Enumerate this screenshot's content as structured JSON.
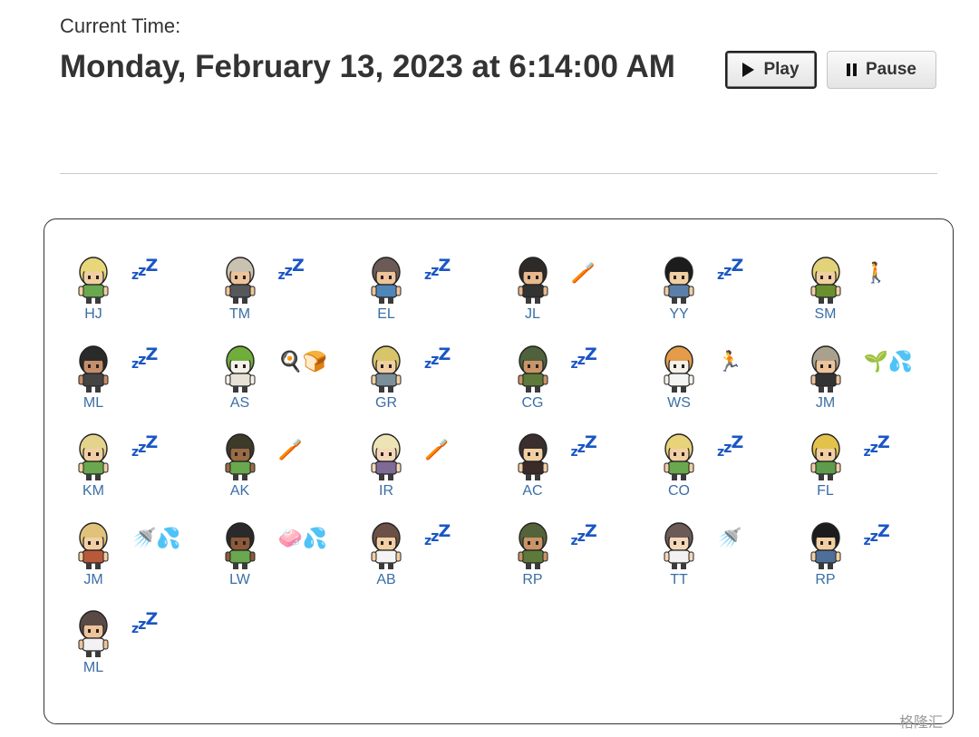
{
  "header": {
    "current_time_label": "Current Time:",
    "current_time_value": "Monday, February 13, 2023 at 6:14:00 AM"
  },
  "controls": {
    "play_label": "Play",
    "pause_label": "Pause"
  },
  "personas": [
    {
      "initials": "HJ",
      "status": "😴",
      "hair": "#e8d77a",
      "skin": "#f2cfa2",
      "shirt": "#6aa84f"
    },
    {
      "initials": "TM",
      "status": "😴",
      "hair": "#c9c2b2",
      "skin": "#eec39a",
      "shirt": "#55575a"
    },
    {
      "initials": "EL",
      "status": "😴",
      "hair": "#6b5a55",
      "skin": "#eec39a",
      "shirt": "#4f86b8"
    },
    {
      "initials": "JL",
      "status": "🪥",
      "hair": "#2e2a28",
      "skin": "#e9b98e",
      "shirt": "#333333"
    },
    {
      "initials": "YY",
      "status": "😴",
      "hair": "#1c1c1c",
      "skin": "#f2cfa2",
      "shirt": "#5a7fa8"
    },
    {
      "initials": "SM",
      "status": "🚶",
      "hair": "#e2d27a",
      "skin": "#f2cfa2",
      "shirt": "#6a8f2f"
    },
    {
      "initials": "ML",
      "status": "😴",
      "hair": "#2a2a2a",
      "skin": "#c58e6a",
      "shirt": "#444444"
    },
    {
      "initials": "AS",
      "status": "🍳🍞",
      "hair": "#6fae3a",
      "skin": "#f6f1e8",
      "shirt": "#e8e2d6"
    },
    {
      "initials": "GR",
      "status": "😴",
      "hair": "#d7c56a",
      "skin": "#f2cfa2",
      "shirt": "#7a8f9a"
    },
    {
      "initials": "CG",
      "status": "😴",
      "hair": "#50613d",
      "skin": "#c99468",
      "shirt": "#5d7a3a"
    },
    {
      "initials": "WS",
      "status": "🏃",
      "hair": "#e49b4a",
      "skin": "#f6f1e8",
      "shirt": "#f4f4f4"
    },
    {
      "initials": "JM",
      "status": "🌱💦",
      "hair": "#a9a18e",
      "skin": "#eec39a",
      "shirt": "#333333"
    },
    {
      "initials": "KM",
      "status": "😴",
      "hair": "#e3d38c",
      "skin": "#f2cfa2",
      "shirt": "#6aa84f"
    },
    {
      "initials": "AK",
      "status": "🪥",
      "hair": "#3d3a2a",
      "skin": "#9a6b45",
      "shirt": "#6aa84f"
    },
    {
      "initials": "IR",
      "status": "🪥",
      "hair": "#ede4b6",
      "skin": "#f5d7b8",
      "shirt": "#7d6b95"
    },
    {
      "initials": "AC",
      "status": "😴",
      "hair": "#3a2e2e",
      "skin": "#f2cfa2",
      "shirt": "#3a2a2a"
    },
    {
      "initials": "CO",
      "status": "😴",
      "hair": "#e8d27a",
      "skin": "#f2cfa2",
      "shirt": "#6aa84f"
    },
    {
      "initials": "FL",
      "status": "😴",
      "hair": "#e2c24a",
      "skin": "#f2cfa2",
      "shirt": "#5c9c4a"
    },
    {
      "initials": "JM",
      "status": "🚿💦",
      "hair": "#e0c27a",
      "skin": "#f2cfa2",
      "shirt": "#b85a3a"
    },
    {
      "initials": "LW",
      "status": "🧼💦",
      "hair": "#2a2a2a",
      "skin": "#8c5a3a",
      "shirt": "#6aa84f"
    },
    {
      "initials": "AB",
      "status": "😴",
      "hair": "#6b5045",
      "skin": "#f2cfa2",
      "shirt": "#f4f4f4"
    },
    {
      "initials": "RP",
      "status": "😴",
      "hair": "#55633a",
      "skin": "#c99468",
      "shirt": "#5d7a3a"
    },
    {
      "initials": "TT",
      "status": "🚿",
      "hair": "#6b5a55",
      "skin": "#f5d7b8",
      "shirt": "#f2f2f2"
    },
    {
      "initials": "RP",
      "status": "😴",
      "hair": "#1c1c1c",
      "skin": "#f2cfa2",
      "shirt": "#4f6f98"
    },
    {
      "initials": "ML",
      "status": "😴",
      "hair": "#5a4a45",
      "skin": "#eec39a",
      "shirt": "#f2f2f2"
    }
  ],
  "watermark": "格隆汇"
}
